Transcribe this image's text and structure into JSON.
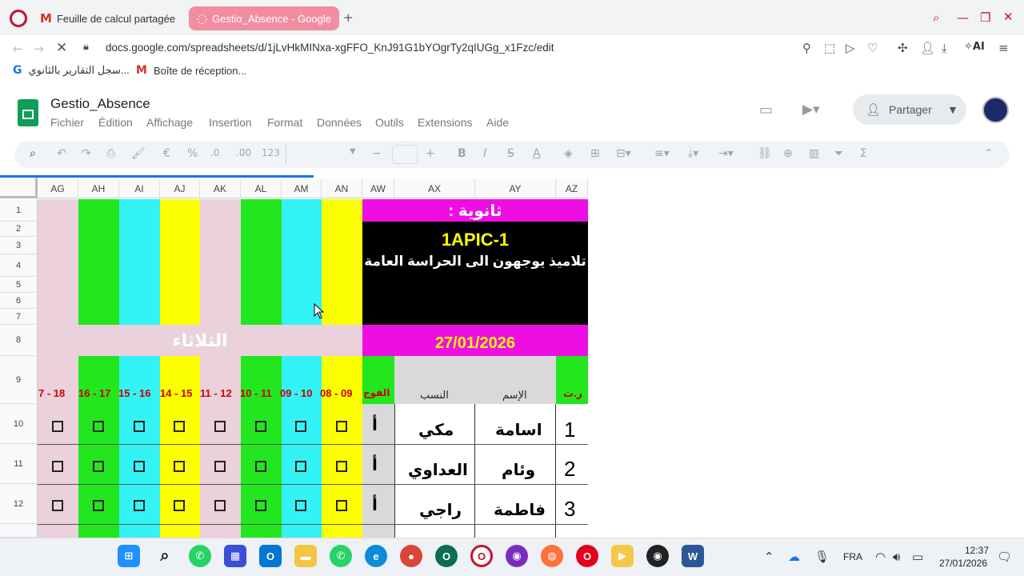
{
  "browser": {
    "tabs": [
      {
        "label": "Feuille de calcul partagée"
      },
      {
        "label": "Gestio_Absence - Google"
      }
    ],
    "url": "docs.google.com/spreadsheets/d/1jLvHkMINxa-xgFFO_KnJ91G1bYOgrTy2qIUGg_x1Fzc/edit",
    "bookmarks": [
      {
        "label": "سجل التقارير بالثانوي..."
      },
      {
        "label": "Boîte de réception..."
      }
    ]
  },
  "sheet": {
    "title": "Gestio_Absence",
    "menus": [
      "Fichier",
      "Édition",
      "Affichage",
      "Insertion",
      "Format",
      "Données",
      "Outils",
      "Extensions",
      "Aide"
    ],
    "share_label": "Partager",
    "toolbar": {
      "number_format": "123"
    },
    "columns": [
      "AG",
      "AH",
      "AI",
      "AJ",
      "AK",
      "AL",
      "AM",
      "AN",
      "AW",
      "AX",
      "AY",
      "AZ"
    ],
    "rows": [
      "1",
      "2",
      "3",
      "4",
      "5",
      "6",
      "7",
      "8",
      "9",
      "10",
      "11",
      "12"
    ],
    "school_label": "ثانوية :",
    "class_code": "1APIC-1",
    "subtitle": "تلاميذ يوجهون الى الحراسة العامة",
    "day": "الثلاثاء",
    "date": "27/01/2026",
    "headers": {
      "group": "الفوج",
      "surname": "النسب",
      "name": "الإسم",
      "number": "ر.ت"
    },
    "periods": [
      "7 - 18",
      "16 - 17",
      "15 - 16",
      "14 - 15",
      "11 - 12",
      "10 - 11",
      "09 - 10",
      "08 - 09"
    ],
    "students": [
      {
        "num": "1",
        "name": "اسامة",
        "surname": "مكي",
        "group": "أ"
      },
      {
        "num": "2",
        "name": "وئام",
        "surname": "العداوي",
        "group": "أ"
      },
      {
        "num": "3",
        "name": "فاطمة",
        "surname": "راجي",
        "group": "أ"
      }
    ],
    "colors": {
      "pink": "#ead1dc",
      "green": "#22e61e",
      "cyan": "#33f3f5",
      "yellow": "#fcff00",
      "magenta": "#ee0ee4",
      "black": "#000000"
    }
  },
  "taskbar": {
    "lang": "FRA",
    "time": "12:37",
    "date": "27/01/2026"
  }
}
